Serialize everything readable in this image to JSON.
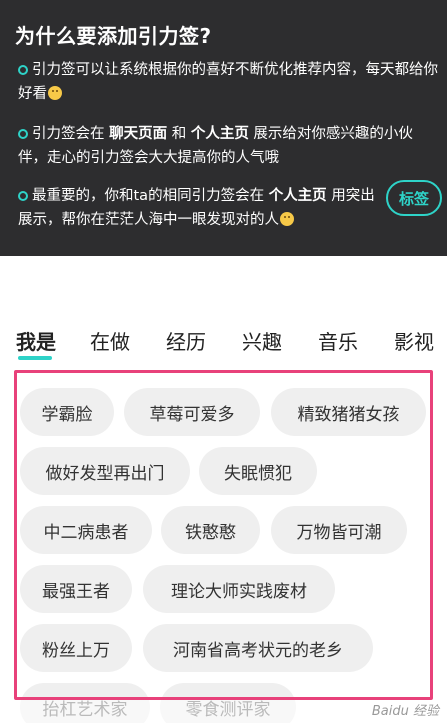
{
  "panel": {
    "title": "为什么要添加引力签?",
    "p1_text": "引力签可以让系统根据你的喜好不断优化推荐内容，每天都给你好看",
    "p2_prefix": "引力签会在 ",
    "p2_bold1": "聊天页面",
    "p2_mid": " 和 ",
    "p2_bold2": "个人主页",
    "p2_suffix": " 展示给对你感兴趣的小伙伴，走心的引力签会大大提高你的人气哦",
    "p3_prefix": "最重要的，你和ta的相同引力签会在 ",
    "p3_bold": "个人主页",
    "p3_suffix": " 用突出展示，帮你在茫茫人海中一眼发现对的人",
    "chip_label": "标签"
  },
  "tabs": [
    "我是",
    "在做",
    "经历",
    "兴趣",
    "音乐",
    "影视"
  ],
  "active_tab": "我是",
  "tags": [
    "学霸脸",
    "草莓可爱多",
    "精致猪猪女孩",
    "做好发型再出门",
    "失眠惯犯",
    "中二病患者",
    "铁憨憨",
    "万物皆可潮",
    "最强王者",
    "理论大师实践废材",
    "粉丝上万",
    "河南省高考状元的老乡",
    "抬杠艺术家",
    "零食测评家"
  ],
  "watermark": "Baidu 经验",
  "colors": {
    "accent": "#2ed3c8",
    "highlight_box": "#e8417a",
    "panel_bg": "#2d2d2f"
  }
}
